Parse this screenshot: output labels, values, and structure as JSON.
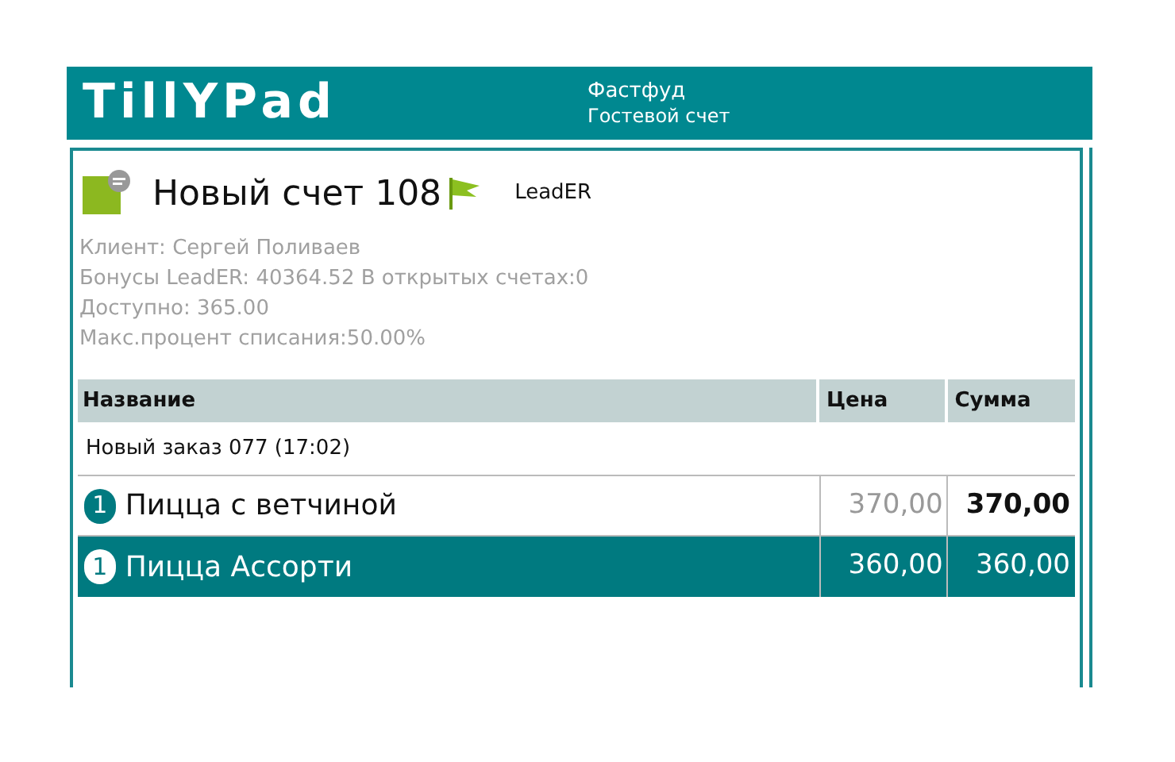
{
  "header": {
    "logo": "TillYPad",
    "title": "Фастфуд",
    "subtitle": "Гостевой счет"
  },
  "bill": {
    "title": "Новый счет 108",
    "program": "LeadER",
    "info": [
      "Клиент: Сергей Поливаев",
      "Бонусы LeadER: 40364.52 В открытых счетах:0",
      "Доступно: 365.00",
      "Макс.процент списания:50.00%"
    ]
  },
  "table": {
    "columns": [
      "Название",
      "Цена",
      "Сумма"
    ],
    "group": "Новый заказ 077 (17:02)",
    "rows": [
      {
        "qty": "1",
        "name": "Пицца с ветчиной",
        "price": "370,00",
        "sum": "370,00",
        "selected": false
      },
      {
        "qty": "1",
        "name": "Пицца Ассорти",
        "price": "360,00",
        "sum": "360,00",
        "selected": true
      }
    ]
  }
}
